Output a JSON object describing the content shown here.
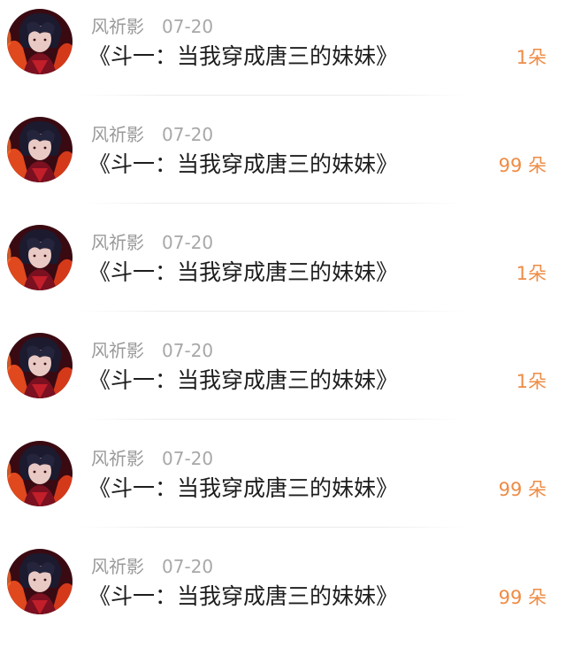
{
  "items": [
    {
      "user": "风祈影",
      "date": "07-20",
      "title": "《斗一：当我穿成唐三的妹妹》",
      "count": "1朵"
    },
    {
      "user": "风祈影",
      "date": "07-20",
      "title": "《斗一：当我穿成唐三的妹妹》",
      "count": "99 朵"
    },
    {
      "user": "风祈影",
      "date": "07-20",
      "title": "《斗一：当我穿成唐三的妹妹》",
      "count": "1朵"
    },
    {
      "user": "风祈影",
      "date": "07-20",
      "title": "《斗一：当我穿成唐三的妹妹》",
      "count": "1朵"
    },
    {
      "user": "风祈影",
      "date": "07-20",
      "title": "《斗一：当我穿成唐三的妹妹》",
      "count": "99 朵"
    },
    {
      "user": "风祈影",
      "date": "07-20",
      "title": "《斗一：当我穿成唐三的妹妹》",
      "count": "99 朵"
    }
  ],
  "colors": {
    "accent": "#ee8c46",
    "meta_text": "#9a9a9a",
    "title_text": "#1e1e1e"
  },
  "icons": {
    "avatar": "user-avatar-icon"
  }
}
